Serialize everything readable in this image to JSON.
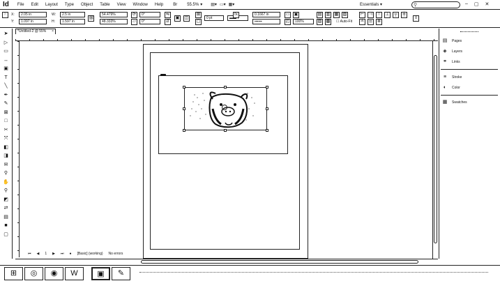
{
  "app": {
    "logo": "Id",
    "menu": [
      "File",
      "Edit",
      "Layout",
      "Type",
      "Object",
      "Table",
      "View",
      "Window",
      "Help"
    ],
    "zoom": "55.5%",
    "workspace": "Essentials",
    "search_placeholder": "",
    "window_controls": [
      "–",
      "▢",
      "✕"
    ]
  },
  "control_bar": {
    "x_label": "X:",
    "x_value": "2.05 in",
    "y_label": "Y:",
    "y_value": "1.097 in",
    "w_label": "W:",
    "w_value": "2.5 in",
    "h_label": "H:",
    "h_value": "1.597 in",
    "scale_x": "54.479%",
    "scale_y": "48.333%",
    "rotate_value": "0°",
    "shear_value": "0°",
    "stroke_weight": "0 pt",
    "opacity": "100%",
    "stroke_value": "0.1667 in",
    "autofit_label": "Auto-Fit"
  },
  "document_tab": {
    "title": "*Untitled-2 @ 55%",
    "close": "×"
  },
  "status": {
    "page": "1",
    "state_label": "[Basic] (working)",
    "preflight": "No errors"
  },
  "panels": {
    "items": [
      {
        "icon": "pages-icon",
        "glyph": "▤",
        "label": "Pages"
      },
      {
        "icon": "layers-icon",
        "glyph": "◈",
        "label": "Layers"
      },
      {
        "icon": "links-icon",
        "glyph": "⚭",
        "label": "Links"
      },
      {
        "icon": "stroke-icon",
        "glyph": "≡",
        "label": "Stroke"
      },
      {
        "icon": "color-icon",
        "glyph": "◐",
        "label": "Color"
      },
      {
        "icon": "swatches-icon",
        "glyph": "▦",
        "label": "Swatches"
      }
    ]
  },
  "tools": [
    {
      "name": "selection-tool-icon",
      "glyph": "➤"
    },
    {
      "name": "direct-selection-tool-icon",
      "glyph": "▷"
    },
    {
      "name": "page-tool-icon",
      "glyph": "▭"
    },
    {
      "name": "gap-tool-icon",
      "glyph": "↔"
    },
    {
      "name": "content-collector-icon",
      "glyph": "▣"
    },
    {
      "name": "type-tool-icon",
      "glyph": "T"
    },
    {
      "name": "line-tool-icon",
      "glyph": "╲"
    },
    {
      "name": "pen-tool-icon",
      "glyph": "✒"
    },
    {
      "name": "pencil-tool-icon",
      "glyph": "✎"
    },
    {
      "name": "rectangle-frame-tool-icon",
      "glyph": "⊠"
    },
    {
      "name": "rectangle-tool-icon",
      "glyph": "□"
    },
    {
      "name": "scissors-tool-icon",
      "glyph": "✂"
    },
    {
      "name": "free-transform-tool-icon",
      "glyph": "⤧"
    },
    {
      "name": "gradient-swatch-tool-icon",
      "glyph": "◧"
    },
    {
      "name": "gradient-feather-tool-icon",
      "glyph": "◨"
    },
    {
      "name": "note-tool-icon",
      "glyph": "✉"
    },
    {
      "name": "eyedropper-tool-icon",
      "glyph": "⚲"
    },
    {
      "name": "hand-tool-icon",
      "glyph": "✋"
    },
    {
      "name": "zoom-tool-icon",
      "glyph": "⚲"
    },
    {
      "name": "fill-stroke-icon",
      "glyph": "◩"
    },
    {
      "name": "swap-icon",
      "glyph": "⇄"
    },
    {
      "name": "formatting-icon",
      "glyph": "▤"
    },
    {
      "name": "apply-color-icon",
      "glyph": "■"
    },
    {
      "name": "screen-mode-icon",
      "glyph": "▢"
    }
  ],
  "taskbar": [
    {
      "name": "windows-start-icon",
      "glyph": "⊞"
    },
    {
      "name": "browser-icon",
      "glyph": "◎"
    },
    {
      "name": "chrome-icon",
      "glyph": "◉"
    },
    {
      "name": "word-icon",
      "glyph": "W"
    },
    {
      "name": "indesign-taskbar-icon",
      "glyph": "▣"
    },
    {
      "name": "pen-app-icon",
      "glyph": "✎"
    }
  ]
}
